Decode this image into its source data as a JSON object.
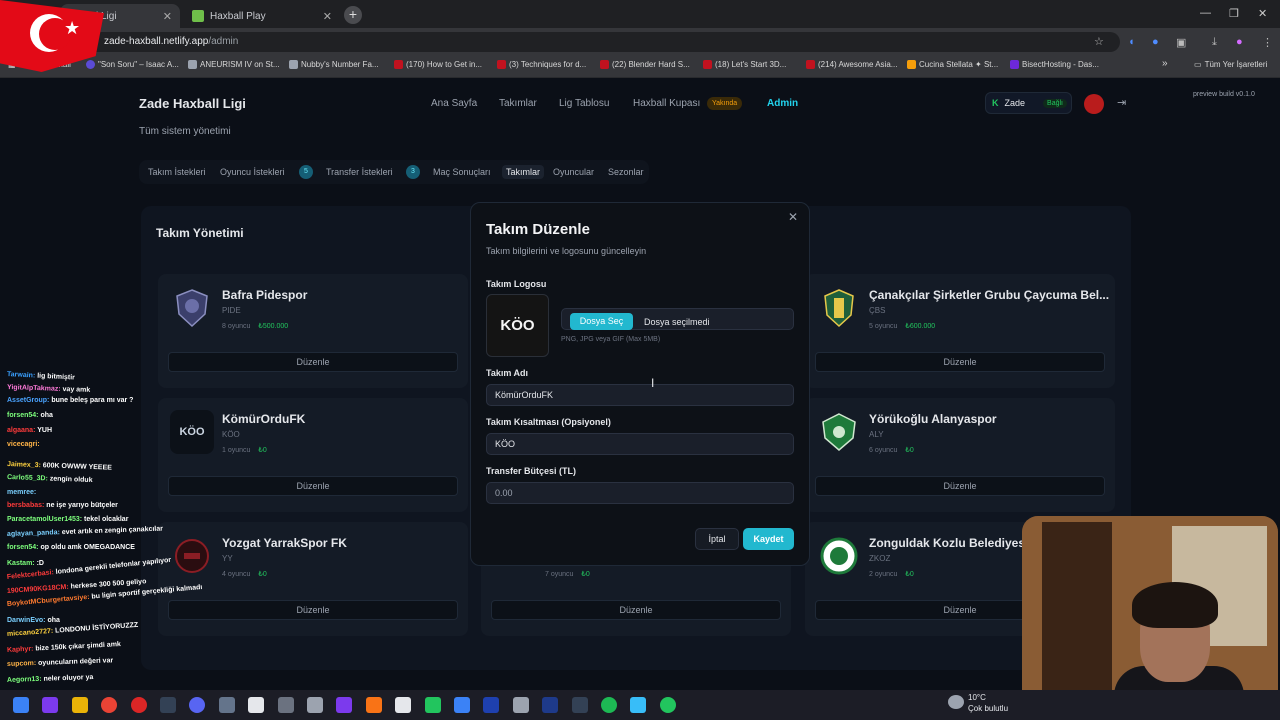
{
  "browser": {
    "tabs": [
      {
        "label": "i Ligi",
        "active": true
      },
      {
        "label": "Haxball Play",
        "active": false
      }
    ],
    "url_host": "zade-haxball.netlify.app",
    "url_path": "/admin",
    "bookmarks": [
      "Gmail",
      "\"Son Soru\" – Isaac A...",
      "ANEURISM IV on St...",
      "Nubby's Number Fa...",
      "(170) How to Get in...",
      "(3) Techniques for d...",
      "(22) Blender Hard S...",
      "(18) Let's Start 3D...",
      "(214) Awesome Asia...",
      "Cucina Stellata ✦ St...",
      "BisectHosting - Das..."
    ],
    "all_bookmarks": "Tüm Yer İşaretleri"
  },
  "site": {
    "title": "Zade Haxball Ligi",
    "subtitle": "Tüm sistem yönetimi",
    "nav": [
      "Ana Sayfa",
      "Takımlar",
      "Lig Tablosu",
      "Haxball Kupası",
      "Admin"
    ],
    "soon_badge": "Yakında",
    "user_initial": "K",
    "user_name": "Zade",
    "user_status": "Bağlı",
    "build": "preview build v0.1.0",
    "admin_tabs": [
      "Takım İstekleri",
      "Oyuncu İstekleri",
      "Transfer İstekleri",
      "Maç Sonuçları",
      "Takımlar",
      "Oyuncular",
      "Sezonlar"
    ],
    "counts": {
      "oyuncu": "5",
      "transfer": "3"
    },
    "panel_title": "Takım Yönetimi",
    "edit_label": "Düzenle",
    "cards": [
      {
        "name": "Bafra Pidespor",
        "abbr": "PIDE",
        "players": "8 oyuncu",
        "money": "₺500.000",
        "logo": ""
      },
      {
        "name": "Çanakçılar Şirketler Grubu Çaycuma Bel...",
        "abbr": "ÇBS",
        "players": "5 oyuncu",
        "money": "₺600.000",
        "logo": ""
      },
      {
        "name": "KömürOrduFK",
        "abbr": "KÖO",
        "players": "1 oyuncu",
        "money": "₺0",
        "logo": "KÖO"
      },
      {
        "name": "Yörükoğlu Alanyaspor",
        "abbr": "ALY",
        "players": "6 oyuncu",
        "money": "₺0",
        "logo": ""
      },
      {
        "name": "Yozgat YarrakSpor FK",
        "abbr": "YY",
        "players": "4 oyuncu",
        "money": "₺0",
        "logo": ""
      },
      {
        "name": "",
        "abbr": "",
        "players": "7 oyuncu",
        "money": "₺0",
        "logo": ""
      },
      {
        "name": "Zonguldak Kozlu Belediyesp",
        "abbr": "ZKOZ",
        "players": "2 oyuncu",
        "money": "₺0",
        "logo": ""
      }
    ]
  },
  "modal": {
    "title": "Takım Düzenle",
    "subtitle": "Takım bilgilerini ve logosunu güncelleyin",
    "logo_label": "Takım Logosu",
    "logo_text": "KÖO",
    "file_button": "Dosya Seç",
    "file_status": "Dosya seçilmedi",
    "file_hint": "PNG, JPG veya GIF (Max 5MB)",
    "name_label": "Takım Adı",
    "name_value": "KömürOrduFK",
    "abbr_label": "Takım Kısaltması (Opsiyonel)",
    "abbr_value": "KÖO",
    "budget_label": "Transfer Bütçesi (TL)",
    "budget_placeholder": "0.00",
    "cancel": "İptal",
    "save": "Kaydet"
  },
  "chat": [
    {
      "user": "Tarwain:",
      "msg": "lig bitmiştir",
      "color": "#3aa0ff"
    },
    {
      "user": "YigitAlpTakmaz:",
      "msg": "vay amk",
      "color": "#ff7ad9"
    },
    {
      "user": "AssetGroup:",
      "msg": "bune beleş para mı var ?",
      "color": "#4aa3ff"
    },
    {
      "user": "forsen54:",
      "msg": "oha",
      "color": "#7dff7d"
    },
    {
      "user": "algaana:",
      "msg": "YUH",
      "color": "#ff3b3b"
    },
    {
      "user": "vicecagri:",
      "msg": "",
      "color": "#ffb347"
    },
    {
      "user": "Jaimex_3:",
      "msg": "600K OWWW YEEEE",
      "color": "#ffd23f"
    },
    {
      "user": "Carlo55_3D:",
      "msg": "zengin olduk",
      "color": "#7dff7d"
    },
    {
      "user": "memree:",
      "msg": "",
      "color": "#7ad0ff"
    },
    {
      "user": "bersbabas:",
      "msg": "ne işe yarıyo bütçeler",
      "color": "#ff3b3b"
    },
    {
      "user": "ParacetamolUser1453:",
      "msg": "tekel olcaklar",
      "color": "#7dff7d"
    },
    {
      "user": "aglayan_panda:",
      "msg": "evet artık en zengin çanakcılar",
      "color": "#7ad0ff"
    },
    {
      "user": "forsen54:",
      "msg": "op oldu amk OMEGADANCE",
      "color": "#7dff7d"
    },
    {
      "user": "Kastam:",
      "msg": ":D",
      "color": "#7dff7d"
    },
    {
      "user": "Felektcerbasi:",
      "msg": "londona gerekli telefonlar yapılıyor",
      "color": "#ff3b3b"
    },
    {
      "user": "190CM90KG18CM:",
      "msg": "herkese 300 500 geliyo",
      "color": "#ff3b3b"
    },
    {
      "user": "BoykotMCburgertavsiye:",
      "msg": "bu ligin sportif gerçekliği kalmadı",
      "color": "#ff7a2f"
    },
    {
      "user": "DarwinEvo:",
      "msg": "oha",
      "color": "#7ad0ff"
    },
    {
      "user": "miccano2727:",
      "msg": "LONDONU İSTİYORUZZZ",
      "color": "#ffd23f"
    },
    {
      "user": "Kaphyr:",
      "msg": "bize 150k çıkar şimdi amk",
      "color": "#ff3b3b"
    },
    {
      "user": "supcom:",
      "msg": "oyuncuların değeri var",
      "color": "#ffb347"
    },
    {
      "user": "Aegorn13:",
      "msg": "neler oluyor ya",
      "color": "#7dff7d"
    }
  ],
  "weather": {
    "temp": "10°C",
    "desc": "Çok bulutlu"
  },
  "taskbar_icons": [
    "windows-icon",
    "copilot-icon",
    "files-icon",
    "chrome-icon",
    "opera-icon",
    "steam-icon",
    "discord-icon",
    "app-icon",
    "unreal-icon",
    "github-icon",
    "unity-icon",
    "visual-studio-icon",
    "blender-icon",
    "app-icon",
    "pycharm-icon",
    "davinci-icon",
    "fresco-icon",
    "inkscape-icon",
    "photoshop-icon",
    "steam-icon",
    "spotify-icon",
    "libreoffice-icon",
    "xbox-icon"
  ],
  "colors": {
    "accent": "#22b8cf",
    "admin": "#22d3ee",
    "money": "#22c55e",
    "warning": "#f59e0b"
  }
}
